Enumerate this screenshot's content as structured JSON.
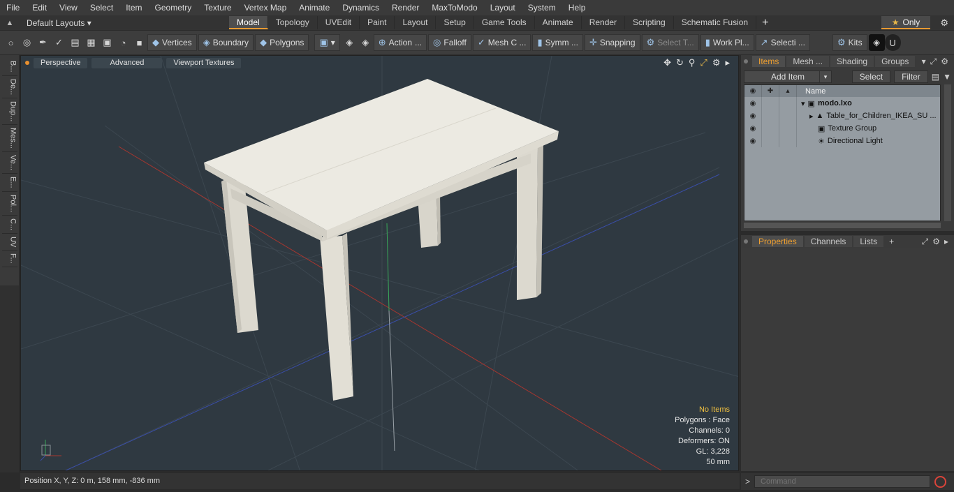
{
  "menu": [
    "File",
    "Edit",
    "View",
    "Select",
    "Item",
    "Geometry",
    "Texture",
    "Vertex Map",
    "Animate",
    "Dynamics",
    "Render",
    "MaxToModo",
    "Layout",
    "System",
    "Help"
  ],
  "layouts_label": "Default Layouts",
  "tabs": [
    {
      "label": "Model",
      "active": true
    },
    {
      "label": "Topology"
    },
    {
      "label": "UVEdit"
    },
    {
      "label": "Paint"
    },
    {
      "label": "Layout"
    },
    {
      "label": "Setup"
    },
    {
      "label": "Game Tools"
    },
    {
      "label": "Animate"
    },
    {
      "label": "Render"
    },
    {
      "label": "Scripting"
    },
    {
      "label": "Schematic Fusion"
    }
  ],
  "only_label": "Only",
  "toolbar": {
    "vertices": "Vertices",
    "boundary": "Boundary",
    "polygons": "Polygons",
    "action": "Action",
    "falloff": "Falloff",
    "mesh": "Mesh C ...",
    "symm": "Symm ...",
    "snapping": "Snapping",
    "select_t": "Select T...",
    "work_pl": "Work Pl...",
    "selecti": "Selecti ...",
    "kits": "Kits"
  },
  "left_tabs": [
    "B...",
    "De...",
    "Dup...",
    "Mes...",
    "Ve...",
    "E...",
    "Pol...",
    "C...",
    "UV",
    "F..."
  ],
  "viewport": {
    "perspective": "Perspective",
    "advanced": "Advanced",
    "textures": "Viewport Textures",
    "info": {
      "no_items": "No Items",
      "polygons": "Polygons : Face",
      "channels": "Channels: 0",
      "deformers": "Deformers: ON",
      "gl": "GL: 3,228",
      "size": "50 mm"
    }
  },
  "status": "Position X, Y, Z:   0 m, 158 mm, -836 mm",
  "items_panel": {
    "tabs": [
      {
        "label": "Items",
        "active": true
      },
      {
        "label": "Mesh ..."
      },
      {
        "label": "Shading"
      },
      {
        "label": "Groups"
      }
    ],
    "add_item": "Add Item",
    "select": "Select",
    "filter": "Filter",
    "name_header": "Name",
    "rows": [
      {
        "label": "modo.lxo",
        "bold": true
      },
      {
        "label": "Table_for_Children_IKEA_SU ..."
      },
      {
        "label": "Texture Group"
      },
      {
        "label": "Directional Light"
      }
    ]
  },
  "props_panel": {
    "tabs": [
      {
        "label": "Properties",
        "active": true
      },
      {
        "label": "Channels"
      },
      {
        "label": "Lists"
      }
    ]
  },
  "command_placeholder": "Command",
  "colors": {
    "accent": "#e89a32",
    "viewport_bg": "#2f3941",
    "table": "#eceae2"
  }
}
